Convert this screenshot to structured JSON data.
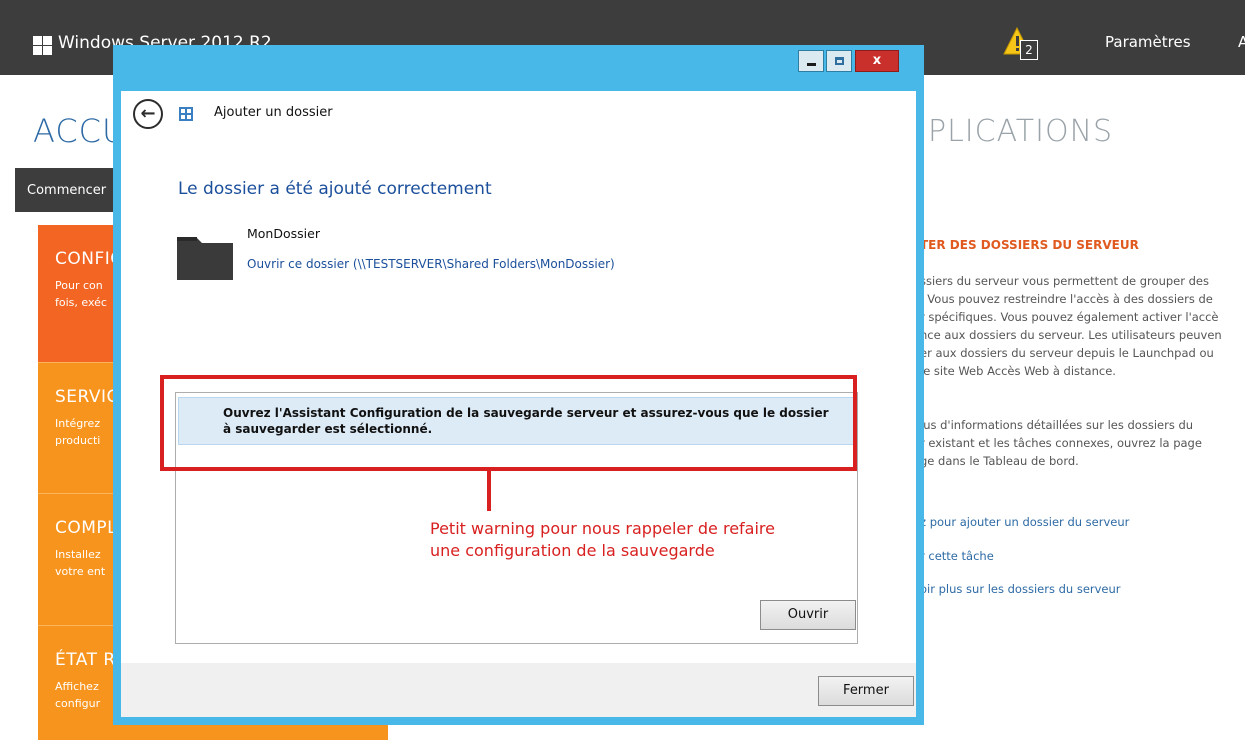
{
  "dashboard": {
    "topbar": {
      "title": "Windows Server 2012 R2",
      "alert_count": "2",
      "settings_label": "Paramètres",
      "more_label": "A"
    },
    "home_title": "ACCUEIL",
    "apps_title": "PLICATIONS",
    "start_tab": "Commencer",
    "tiles": [
      {
        "title": "CONFIG",
        "line1": "Pour con",
        "line2": "fois, exéc",
        "color": "#f26522"
      },
      {
        "title": "SERVIC",
        "line1": "Intégrez",
        "line2": "producti",
        "color": "#f7941d"
      },
      {
        "title": "COMPL",
        "line1": "Installez",
        "line2": "votre ent",
        "color": "#f7941d"
      },
      {
        "title": "ÉTAT RA",
        "line1": "Affichez",
        "line2": "configur",
        "color": "#f7941d"
      }
    ],
    "right_panel": {
      "heading": "TER DES DOSSIERS DU SERVEUR",
      "para1": [
        "ssiers du serveur vous permettent de grouper des",
        ". Vous pouvez restreindre l'accès à des dossiers de",
        "r spécifiques. Vous pouvez également activer l'accè",
        "nce aux dossiers du serveur. Les utilisateurs peuven",
        "er aux dossiers du serveur depuis le Launchpad ou",
        "le site Web Accès Web à distance."
      ],
      "para2": [
        "lus d'informations détaillées sur les dossiers du",
        "r existant et les tâches connexes, ouvrez la page",
        "ge dans le Tableau de bord."
      ],
      "links": [
        "z pour ajouter un dossier du serveur",
        "r cette tâche",
        "oir plus sur les dossiers du serveur"
      ]
    }
  },
  "dialog": {
    "title": "Ajouter un dossier",
    "success_heading": "Le dossier a été ajouté correctement",
    "folder_name": "MonDossier",
    "open_folder_link": "Ouvrir ce dossier (\\\\TESTSERVER\\Shared Folders\\MonDossier)",
    "task_line1": "Ouvrez l'Assistant Configuration de la sauvegarde serveur et assurez-vous que le dossier",
    "task_line2": "à sauvegarder est sélectionné.",
    "open_button": "Ouvrir",
    "close_button": "Fermer",
    "close_glyph": "x",
    "back_glyph": "←"
  },
  "annotation": {
    "line1": "Petit warning pour nous rappeler de refaire",
    "line2": "une configuration de la sauvegarde",
    "color": "#d92020"
  },
  "colors": {
    "topbar": "#3d3d3d",
    "window_chrome": "#48b8e8",
    "accent_blue": "#2d6aa5",
    "tile_orange_dark": "#f26522",
    "tile_orange": "#f7941d"
  }
}
